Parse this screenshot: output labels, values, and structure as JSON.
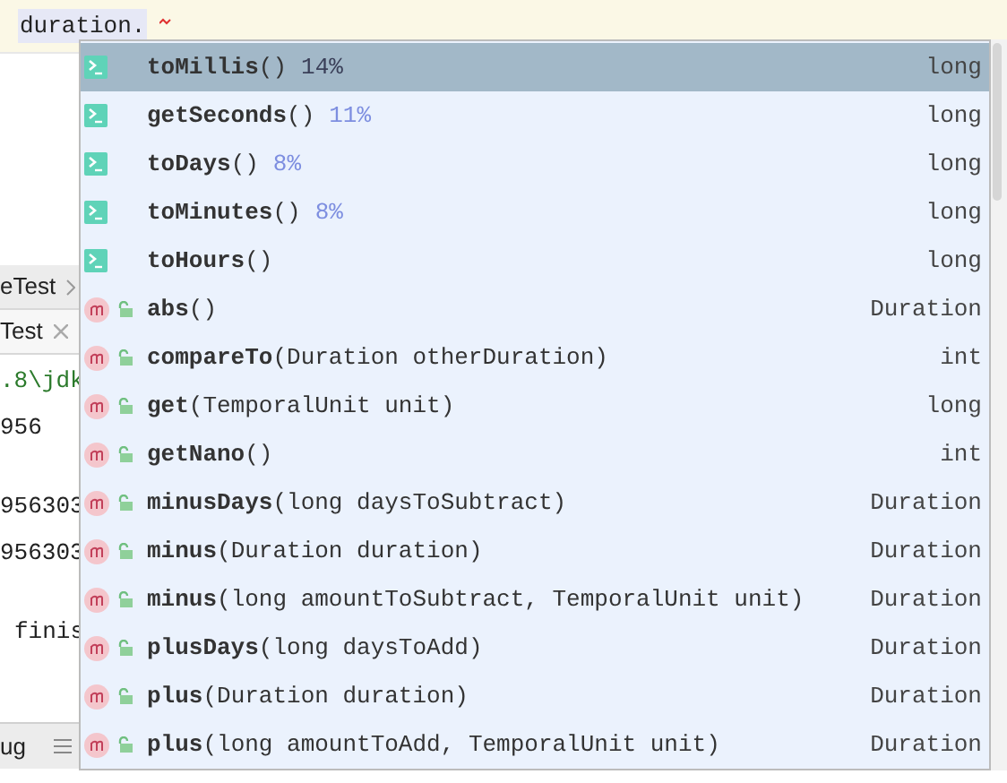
{
  "editor": {
    "code": "duration."
  },
  "tabs": [
    {
      "label": "eTest",
      "kind": "breadcrumb"
    },
    {
      "label": "Test",
      "kind": "closable"
    }
  ],
  "console": [
    {
      "text": ".8\\jdk",
      "kind": "path"
    },
    {
      "text": "956",
      "kind": "output"
    },
    {
      "text": "956303",
      "kind": "output"
    },
    {
      "text": "956303",
      "kind": "output"
    },
    {
      "text": "finis",
      "kind": "output"
    }
  ],
  "bottom_bar": {
    "label": "ug"
  },
  "completion": [
    {
      "kind": "postfix",
      "label": "**toMillis**()",
      "hint": "14%",
      "type": "long",
      "selected": true
    },
    {
      "kind": "postfix",
      "label": "**getSeconds**()",
      "hint": "11%",
      "type": "long",
      "selected": false
    },
    {
      "kind": "postfix",
      "label": "**toDays**()",
      "hint": "8%",
      "type": "long",
      "selected": false
    },
    {
      "kind": "postfix",
      "label": "**toMinutes**()",
      "hint": "8%",
      "type": "long",
      "selected": false
    },
    {
      "kind": "postfix",
      "label": "**toHours**()",
      "type": "long",
      "selected": false
    },
    {
      "kind": "method",
      "label": "**abs**()",
      "type": "Duration",
      "selected": false
    },
    {
      "kind": "method",
      "label": "**compareTo**(Duration otherDuration)",
      "type": "int",
      "selected": false
    },
    {
      "kind": "method",
      "label": "**get**(TemporalUnit unit)",
      "type": "long",
      "selected": false
    },
    {
      "kind": "method",
      "label": "**getNano**()",
      "type": "int",
      "selected": false
    },
    {
      "kind": "method",
      "label": "**minusDays**(long daysToSubtract)",
      "type": "Duration",
      "selected": false
    },
    {
      "kind": "method",
      "label": "**minus**(Duration duration)",
      "type": "Duration",
      "selected": false
    },
    {
      "kind": "method",
      "label": "**minus**(long amountToSubtract, TemporalUnit unit)",
      "type": "Duration",
      "selected": false
    },
    {
      "kind": "method",
      "label": "**plusDays**(long daysToAdd)",
      "type": "Duration",
      "selected": false
    },
    {
      "kind": "method",
      "label": "**plus**(Duration duration)",
      "type": "Duration",
      "selected": false
    },
    {
      "kind": "method",
      "label": "**plus**(long amountToAdd, TemporalUnit unit)",
      "type": "Duration",
      "selected": false
    }
  ]
}
